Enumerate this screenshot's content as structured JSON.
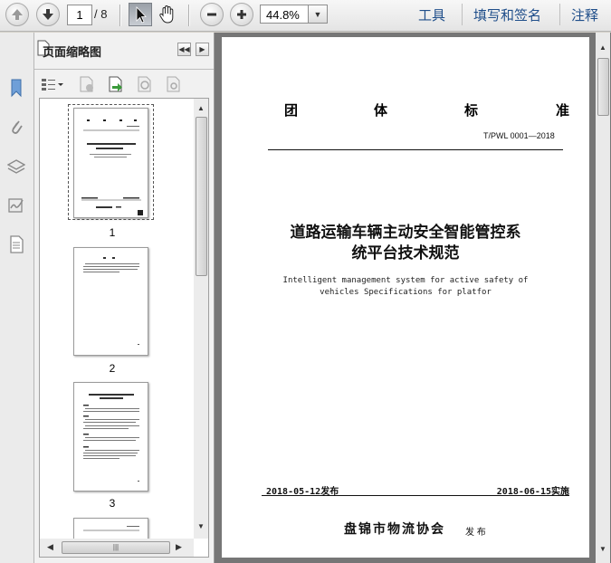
{
  "toolbar": {
    "current_page": "1",
    "total_pages": "/ 8",
    "zoom": "44.8%",
    "links": [
      "工具",
      "填写和签名",
      "注释"
    ]
  },
  "sidebar": {
    "title": "页面缩略图",
    "thumbnails": [
      {
        "label": "1"
      },
      {
        "label": "2"
      },
      {
        "label": "3"
      }
    ]
  },
  "document": {
    "header_chars": [
      "团",
      "体",
      "标",
      "准"
    ],
    "standard_number": "T/PWL 0001—2018",
    "title_line1": "道路运输车辆主动安全智能管控系",
    "title_line2": "统平台技术规范",
    "subtitle_line1": "Intelligent management system for active safety of",
    "subtitle_line2": "vehicles Specifications for platfor",
    "issue_date": "2018-05-12发布",
    "effective_date": "2018-06-15实施",
    "publisher": "盘锦市物流协会",
    "publisher_suffix": "发 布"
  },
  "colors": {
    "link": "#1f4e8a",
    "doc_background": "#767676"
  }
}
